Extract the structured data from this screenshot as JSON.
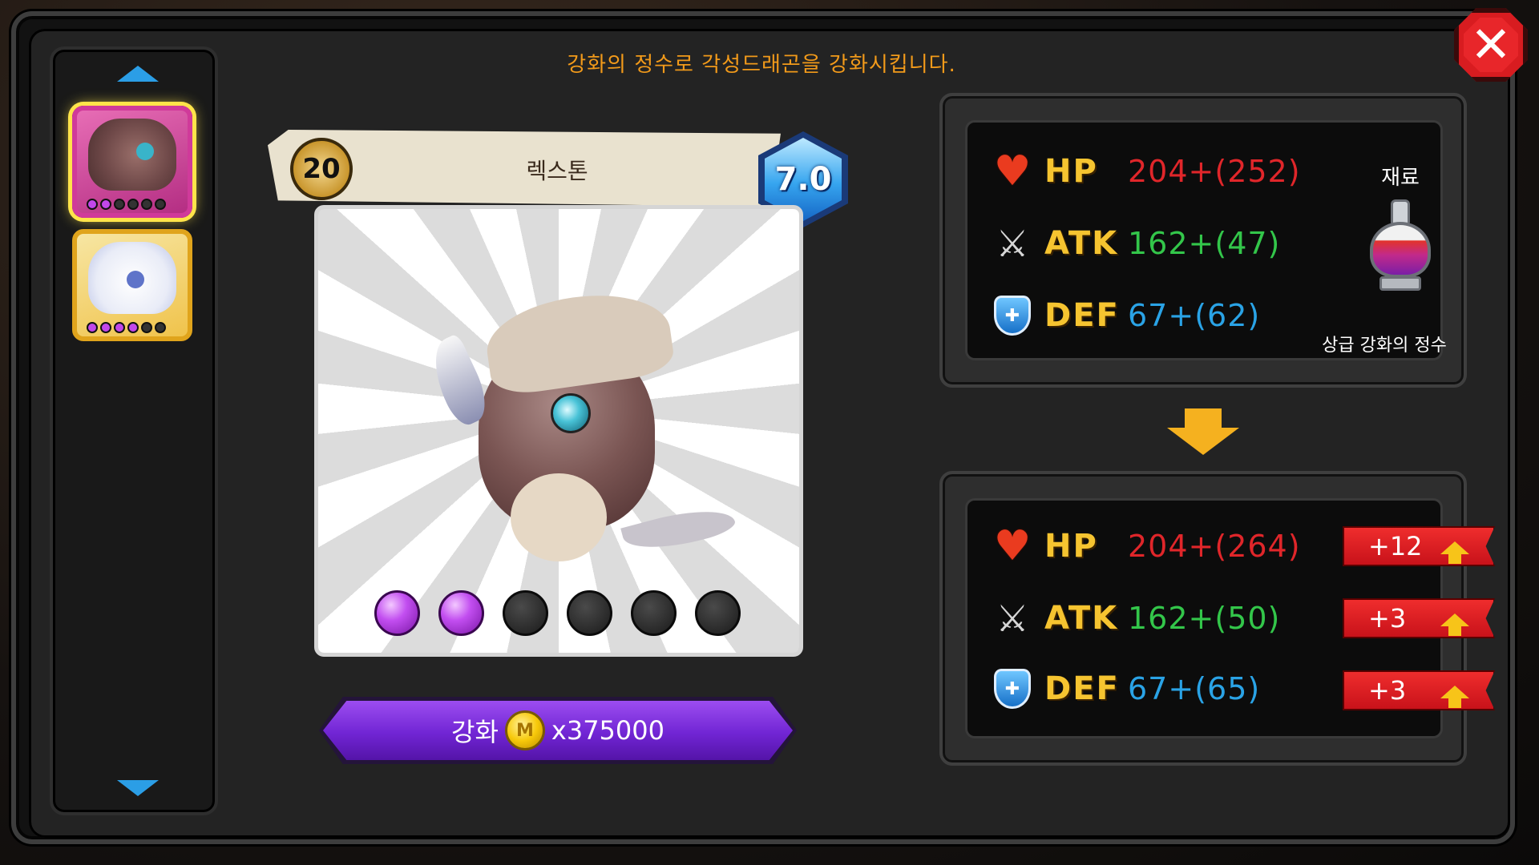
{
  "header": {
    "instruction": "강화의 정수로 각성드래곤을 강화시킵니다."
  },
  "close_button": {
    "label": "✕"
  },
  "sidebar": {
    "portraits": [
      {
        "name": "rexton",
        "selected": true,
        "gems_filled": 2,
        "gems_total": 6
      },
      {
        "name": "white-dragon",
        "selected": false,
        "gems_filled": 4,
        "gems_total": 6
      }
    ]
  },
  "dragon": {
    "level": "20",
    "name": "렉스톤",
    "grade": "7.0",
    "gems_filled": 2,
    "gems_total": 6
  },
  "enhance": {
    "label": "강화",
    "coin_symbol": "M",
    "cost": "x375000"
  },
  "current_stats": {
    "hp_label": "HP",
    "hp_value": "204+(252)",
    "atk_label": "ATK",
    "atk_value": "162+(47)",
    "def_label": "DEF",
    "def_value": "67+(62)"
  },
  "material": {
    "title": "재료",
    "name": "상급 강화의 정수"
  },
  "next_stats": {
    "hp_label": "HP",
    "hp_value": "204+(264)",
    "hp_increase": "+12",
    "atk_label": "ATK",
    "atk_value": "162+(50)",
    "atk_increase": "+3",
    "def_label": "DEF",
    "def_value": "67+(65)",
    "def_increase": "+3"
  },
  "colors": {
    "accent_orange": "#f29a1a",
    "hp_red": "#e0262a",
    "atk_green": "#33c64a",
    "def_blue": "#2aa3e6",
    "label_gold": "#f6c430",
    "button_purple": "#7125d4",
    "increase_red": "#c8121a"
  }
}
